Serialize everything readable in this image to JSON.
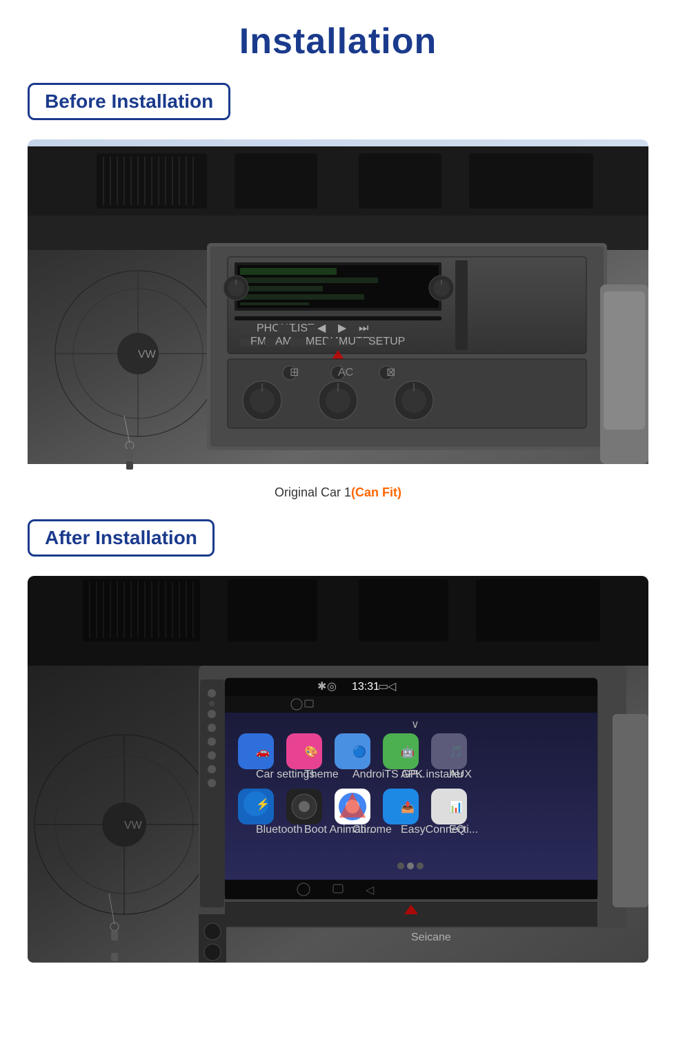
{
  "page": {
    "title": "Installation",
    "background_color": "#ffffff"
  },
  "before_section": {
    "badge_label": "Before Installation",
    "image_alt": "Car dashboard before installation - original radio unit",
    "caption_text": "Original Car  1",
    "caption_highlight": "(Can Fit)"
  },
  "after_section": {
    "badge_label": "After Installation",
    "image_alt": "Car dashboard after installation - Android head unit installed",
    "watermark": "Seicane",
    "status_time": "13:31",
    "apps": [
      {
        "label": "Car settings",
        "bg": "#2e6fdb",
        "icon": "🚗"
      },
      {
        "label": "Theme",
        "bg": "#e84393",
        "icon": "🎨"
      },
      {
        "label": "AndroiTS GP...",
        "bg": "#4a90e2",
        "icon": "🔵"
      },
      {
        "label": "APK installer",
        "bg": "#4caf50",
        "icon": "🤖"
      },
      {
        "label": "AUX",
        "bg": "#5c5c8a",
        "icon": "🎵"
      },
      {
        "label": "Bluetooth",
        "bg": "#1565c0",
        "icon": "🔵"
      },
      {
        "label": "Boot Animati...",
        "bg": "#333",
        "icon": "⚙️"
      },
      {
        "label": "Chrome",
        "bg": "#fff",
        "icon": "🌐"
      },
      {
        "label": "EasyConnecti...",
        "bg": "#1e88e5",
        "icon": "📤"
      },
      {
        "label": "EQ",
        "bg": "#e0e0e0",
        "icon": "📊"
      }
    ]
  },
  "icons": {
    "before_badge_border": "#1a3a8c",
    "after_badge_border": "#1a3a8c",
    "title_color": "#1a3a8c",
    "can_fit_color": "#ff6600"
  }
}
